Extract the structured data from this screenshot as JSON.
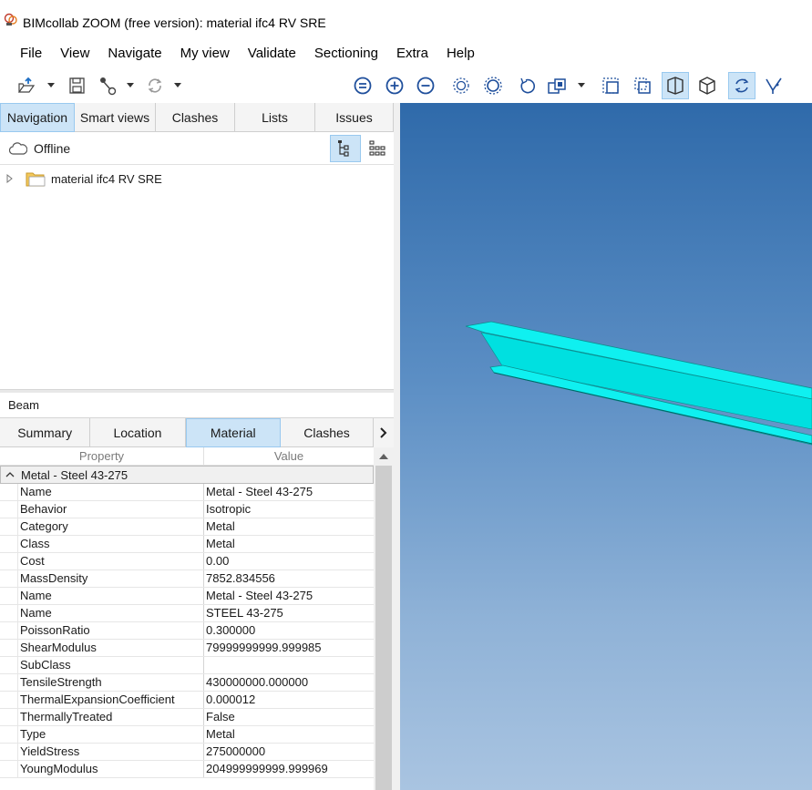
{
  "window": {
    "title": "BIMcollab ZOOM (free version): material ifc4 RV SRE"
  },
  "menu": [
    "File",
    "View",
    "Navigate",
    "My view",
    "Validate",
    "Sectioning",
    "Extra",
    "Help"
  ],
  "toolbar": {
    "buttons": [
      "open-model-icon",
      "save-icon",
      "share-node-icon",
      "sync-icon",
      "fit-all-icon",
      "zoom-in-icon",
      "zoom-out-icon",
      "zoom-selection-icon",
      "zoom-extents-icon",
      "undo-view-icon",
      "render-mode-icon",
      "select-box-icon",
      "select-cross-icon",
      "perspective-view-icon",
      "orthographic-view-icon",
      "orbit-icon",
      "walk-mode-icon"
    ],
    "active": [
      "perspective-view-icon",
      "orbit-icon"
    ]
  },
  "navigation": {
    "tabs": [
      "Navigation",
      "Smart views",
      "Clashes",
      "Lists",
      "Issues"
    ],
    "selected_tab": "Navigation",
    "status": "Offline",
    "tree": [
      {
        "label": "material ifc4 RV SRE",
        "expanded": false
      }
    ]
  },
  "properties": {
    "selected_object": "Beam",
    "tabs": [
      "Summary",
      "Location",
      "Material",
      "Clashes"
    ],
    "selected_tab": "Material",
    "columns": {
      "property": "Property",
      "value": "Value"
    },
    "group": "Metal - Steel 43-275",
    "rows": [
      {
        "property": "Name",
        "value": "Metal - Steel 43-275"
      },
      {
        "property": "Behavior",
        "value": "Isotropic"
      },
      {
        "property": "Category",
        "value": "Metal"
      },
      {
        "property": "Class",
        "value": "Metal"
      },
      {
        "property": "Cost",
        "value": "0.00"
      },
      {
        "property": "MassDensity",
        "value": "7852.834556"
      },
      {
        "property": "Name",
        "value": "Metal - Steel 43-275"
      },
      {
        "property": "Name",
        "value": "STEEL 43-275"
      },
      {
        "property": "PoissonRatio",
        "value": "0.300000"
      },
      {
        "property": "ShearModulus",
        "value": "79999999999.999985"
      },
      {
        "property": "SubClass",
        "value": ""
      },
      {
        "property": "TensileStrength",
        "value": "430000000.000000"
      },
      {
        "property": "ThermalExpansionCoefficient",
        "value": "0.000012"
      },
      {
        "property": "ThermallyTreated",
        "value": "False"
      },
      {
        "property": "Type",
        "value": "Metal"
      },
      {
        "property": "YieldStress",
        "value": "275000000"
      },
      {
        "property": "YoungModulus",
        "value": "204999999999.999969"
      }
    ]
  },
  "viewport": {
    "object_color": "#00f0f0",
    "background_top": "#2f6aaa",
    "background_bottom": "#a9c4e1"
  }
}
